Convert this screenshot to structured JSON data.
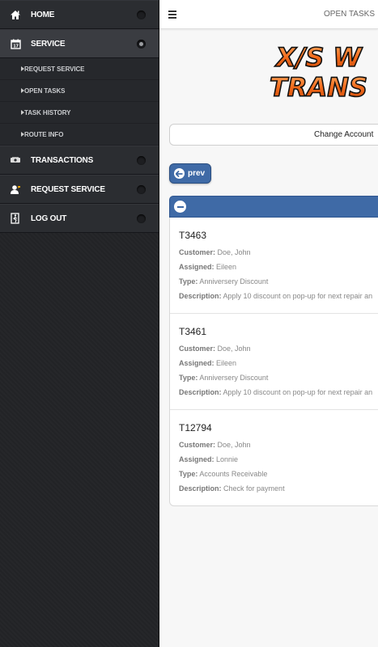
{
  "sidebar": {
    "items": [
      {
        "label": "HOME",
        "icon": "home-icon"
      },
      {
        "label": "SERVICE",
        "icon": "calendar-icon"
      },
      {
        "label": "TRANSACTIONS",
        "icon": "money-icon"
      },
      {
        "label": "REQUEST SERVICE",
        "icon": "user-request-icon"
      },
      {
        "label": "LOG OUT",
        "icon": "logout-icon"
      }
    ],
    "submenu": [
      {
        "label": "REQUEST SERVICE"
      },
      {
        "label": "OPEN TASKS"
      },
      {
        "label": "TASK HISTORY"
      },
      {
        "label": "ROUTE INFO"
      }
    ]
  },
  "header": {
    "title": "OPEN TASKS"
  },
  "logo": {
    "line1": "X/S W",
    "line2": "TRANS",
    "color": "#f26a1b"
  },
  "account_button": {
    "label": "Change Account"
  },
  "prev_button": {
    "label": "prev"
  },
  "field_labels": {
    "customer": "Customer:",
    "assigned": "Assigned:",
    "type": "Type:",
    "description": "Description:"
  },
  "tasks": [
    {
      "id": "T3463",
      "customer": "Doe, John",
      "assigned": "Eileen",
      "type": "Anniversery Discount",
      "description": "Apply 10 discount on pop-up for next repair an"
    },
    {
      "id": "T3461",
      "customer": "Doe, John",
      "assigned": "Eileen",
      "type": "Anniversery Discount",
      "description": "Apply 10 discount on pop-up for next repair an"
    },
    {
      "id": "T12794",
      "customer": "Doe, John",
      "assigned": "Lonnie",
      "type": "Accounts Receivable",
      "description": "Check for payment"
    }
  ],
  "colors": {
    "accent": "#3f6aa6",
    "sidebar_bg": "#232427",
    "logo_orange": "#f26a1b"
  }
}
